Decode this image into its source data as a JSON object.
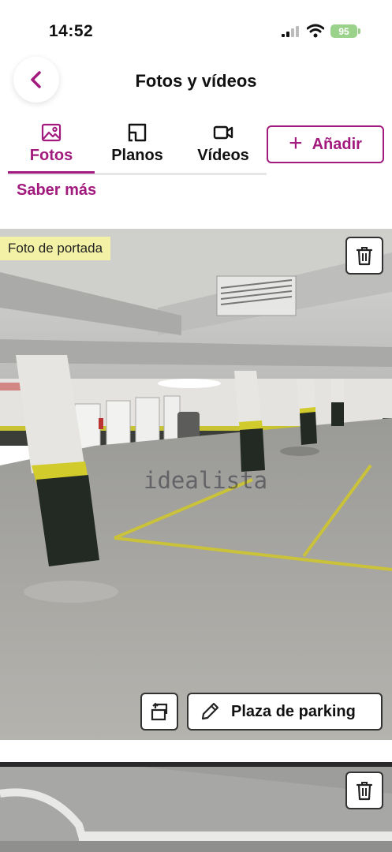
{
  "status_bar": {
    "time": "14:52",
    "battery": "95"
  },
  "header": {
    "title": "Fotos y vídeos"
  },
  "tabs": [
    {
      "label": "Fotos",
      "icon": "image-icon",
      "active": true
    },
    {
      "label": "Planos",
      "icon": "floorplan-icon",
      "active": false
    },
    {
      "label": "Vídeos",
      "icon": "video-camera-icon",
      "active": false
    }
  ],
  "add_button": {
    "label": "Añadir"
  },
  "learn_more": "Saber más",
  "photos": [
    {
      "badge": "Foto de portada",
      "caption": "Plaza de parking",
      "watermark": "idealista"
    },
    {}
  ],
  "colors": {
    "accent": "#a21a7e",
    "badge_bg": "#f3f1a5",
    "battery": "#9ad18b"
  }
}
